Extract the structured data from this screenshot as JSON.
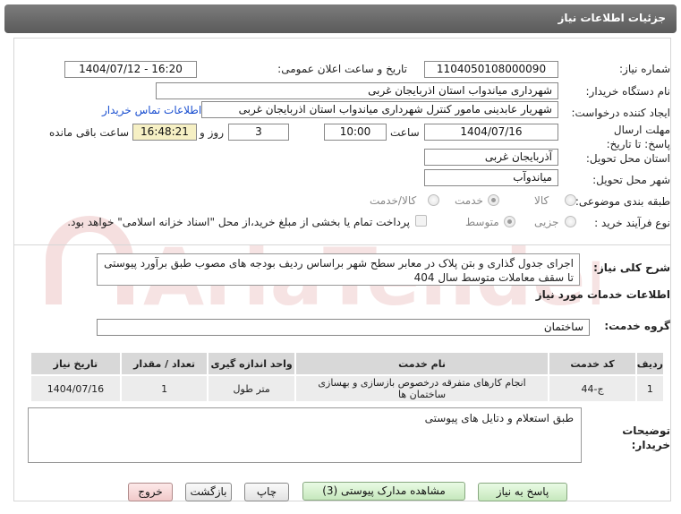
{
  "header": {
    "title": "جزئیات اطلاعات نیاز"
  },
  "labels": {
    "need_number": "شماره نیاز:",
    "announce_datetime": "تاریخ و ساعت اعلان عمومی:",
    "buyer_org": "نام دستگاه خریدار:",
    "requester": "ایجاد کننده درخواست:",
    "deadline": "مهلت ارسال پاسخ: تا تاریخ:",
    "time_word": "ساعت",
    "days_word": "روز و",
    "remaining_word": "ساعت باقی مانده",
    "province": "استان محل تحویل:",
    "city": "شهر محل تحویل:",
    "category": "طبقه بندی موضوعی:",
    "process_type": "نوع فرآیند خرید :",
    "need_desc": "شرح کلی نیاز:",
    "services_info": "اطلاعات خدمات مورد نیاز",
    "service_group": "گروه خدمت:",
    "buyer_notes": "توضیحات خریدار:"
  },
  "values": {
    "need_number": "1104050108000090",
    "announce_datetime": "1404/07/12 - 16:20",
    "buyer_org": "شهرداری میاندواب استان اذربایجان غربی",
    "requester": "شهریار  عابدینی مامور کنترل شهرداری میاندواب استان اذربایجان غربی",
    "contact_link": "اطلاعات تماس خریدار",
    "deadline_date": "1404/07/16",
    "deadline_time": "10:00",
    "days": "3",
    "remaining_time": "16:48:21",
    "province": "آذربایجان غربی",
    "city": "میاندوآب",
    "need_desc": "اجرای جدول گذاری و بتن پلاک در معابر سطح شهر براساس ردیف بودجه های مصوب طبق برآورد پیوستی تا سقف معاملات متوسط سال 404",
    "service_group": "ساختمان",
    "buyer_notes": "طبق استعلام و دتایل های پیوستی"
  },
  "category_options": [
    {
      "label": "کالا",
      "selected": false
    },
    {
      "label": "خدمت",
      "selected": true
    },
    {
      "label": "کالا/خدمت",
      "selected": false
    }
  ],
  "process_options": [
    {
      "label": "جزیی",
      "selected": false
    },
    {
      "label": "متوسط",
      "selected": true
    }
  ],
  "payment_note": "پرداخت تمام یا بخشی از مبلغ خرید،از محل \"اسناد خزانه اسلامی\" خواهد بود.",
  "table": {
    "headers": [
      "ردیف",
      "کد خدمت",
      "نام خدمت",
      "واحد اندازه گیری",
      "تعداد / مقدار",
      "تاریخ نیاز"
    ],
    "rows": [
      [
        "1",
        "ج-44",
        "انجام کارهای متفرقه درخصوص بازسازی و بهسازی ساختمان ها",
        "متر طول",
        "1",
        "1404/07/16"
      ]
    ]
  },
  "buttons": {
    "reply": "پاسخ به نیاز",
    "view_docs": "مشاهده مدارک پیوستی (3)",
    "print": "چاپ",
    "back": "بازگشت",
    "exit": "خروج"
  },
  "watermark": "AriaTender.net",
  "colors": {
    "header": "#666666",
    "link": "#1a4fd0",
    "highlight": "#f6f0c4",
    "watermark": "#e8b8b8"
  }
}
